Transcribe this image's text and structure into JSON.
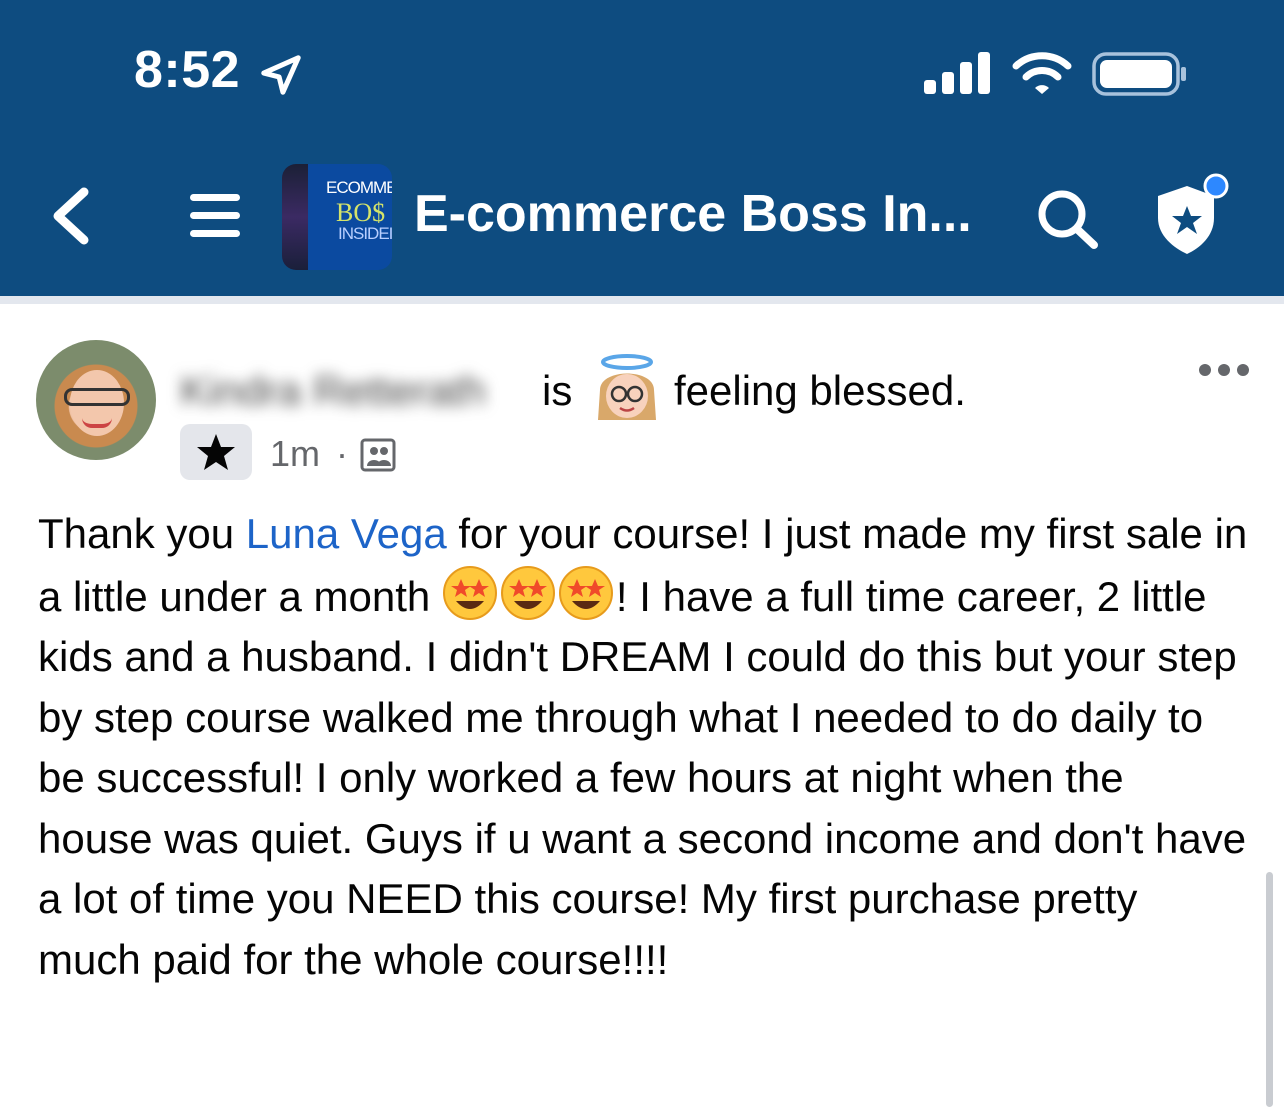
{
  "status_bar": {
    "time": "8:52"
  },
  "header": {
    "group_title": "E-commerce Boss In...",
    "thumbnail": {
      "line1": "ECOMME",
      "line2": "BO$",
      "line3": "INSIDEI"
    }
  },
  "post": {
    "author": "Kindra Retterath",
    "is_label": "is",
    "feeling": "feeling blessed.",
    "time": "1m",
    "separator": "·",
    "body": {
      "part1": "Thank you ",
      "mention": "Luna Vega",
      "part2": " for your course! I just made my first sale in a little under a month ",
      "part3": "! I have a full time career, 2 little kids and a husband. I didn't DREAM I could do this but your step by step course walked me through what I needed to do daily to be successful! I only worked a few hours at night when the house was quiet. Guys if u want a second income and don't have a lot of time you NEED this course! My first purchase pretty much paid for the whole course!!!!"
    }
  },
  "colors": {
    "header_bg": "#0e4c80",
    "mention": "#1d64c8",
    "notification_dot": "#2d88ff"
  },
  "icons": [
    "location-arrow-icon",
    "signal-icon",
    "wifi-icon",
    "battery-icon",
    "back-arrow-icon",
    "menu-icon",
    "search-icon",
    "shield-star-icon",
    "more-icon",
    "star-icon",
    "audience-icon",
    "halo-face-emoji",
    "star-struck-emoji"
  ]
}
